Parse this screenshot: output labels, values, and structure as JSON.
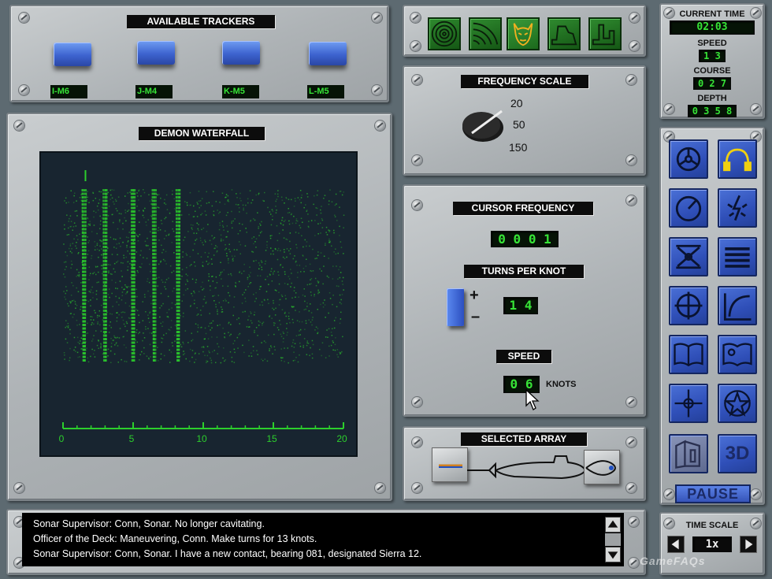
{
  "trackers": {
    "title": "AVAILABLE TRACKERS",
    "items": [
      "I-M6",
      "J-M4",
      "K-M5",
      "L-M5"
    ]
  },
  "mode_buttons": [
    "sonar-rings-icon",
    "arc-sweep-icon",
    "demon-mask-icon",
    "broadband-profile-icon",
    "narrowband-graph-icon"
  ],
  "status": {
    "current_time_label": "CURRENT TIME",
    "current_time": "02:03",
    "speed_label": "SPEED",
    "speed": "1 3",
    "course_label": "COURSE",
    "course": "0 2 7",
    "depth_label": "DEPTH",
    "depth": "0 3 5 8"
  },
  "waterfall": {
    "title": "DEMON WATERFALL",
    "axis_ticks": [
      "0",
      "5",
      "10",
      "15",
      "20"
    ],
    "axis_values": [
      0,
      5,
      10,
      15,
      20
    ],
    "line_frequencies": [
      1.5,
      3,
      5,
      6.5,
      8.2
    ],
    "cursor_frequency": 1.6,
    "axis_max": 20,
    "trace_color": "#2ccf2c"
  },
  "frequency_scale": {
    "title": "FREQUENCY SCALE",
    "options": [
      "20",
      "50",
      "150"
    ]
  },
  "controls": {
    "cursor_frequency_label": "CURSOR FREQUENCY",
    "cursor_frequency": "0 0 0 1",
    "turns_per_knot_label": "TURNS PER KNOT",
    "turns_per_knot": "1 4",
    "plus": "+",
    "minus": "–",
    "speed_label": "SPEED",
    "speed": "0 6",
    "speed_unit": "KNOTS"
  },
  "selected_array": {
    "title": "SELECTED ARRAY"
  },
  "side_buttons": [
    "helm-wheel-icon",
    "headphones-icon",
    "periscope-dial-icon",
    "lightning-icon",
    "torpedo-tube-icon",
    "list-menu-icon",
    "crosshair-icon",
    "curve-plot-icon",
    "book-icon",
    "message-book-icon",
    "compass-icon",
    "star-badge-icon",
    "map-3d-icon"
  ],
  "side_3d_label": "3D",
  "pause_label": "PAUSE",
  "messages": [
    "Sonar Supervisor:  Conn, Sonar.  No longer cavitating.",
    "Officer of the Deck:  Maneuvering, Conn.  Make turns for 13 knots.",
    "Sonar Supervisor:  Conn, Sonar.  I have a new contact, bearing 081, designated Sierra 12."
  ],
  "time_scale": {
    "title": "TIME SCALE",
    "value": "1x"
  },
  "watermark": "GameFAQs"
}
